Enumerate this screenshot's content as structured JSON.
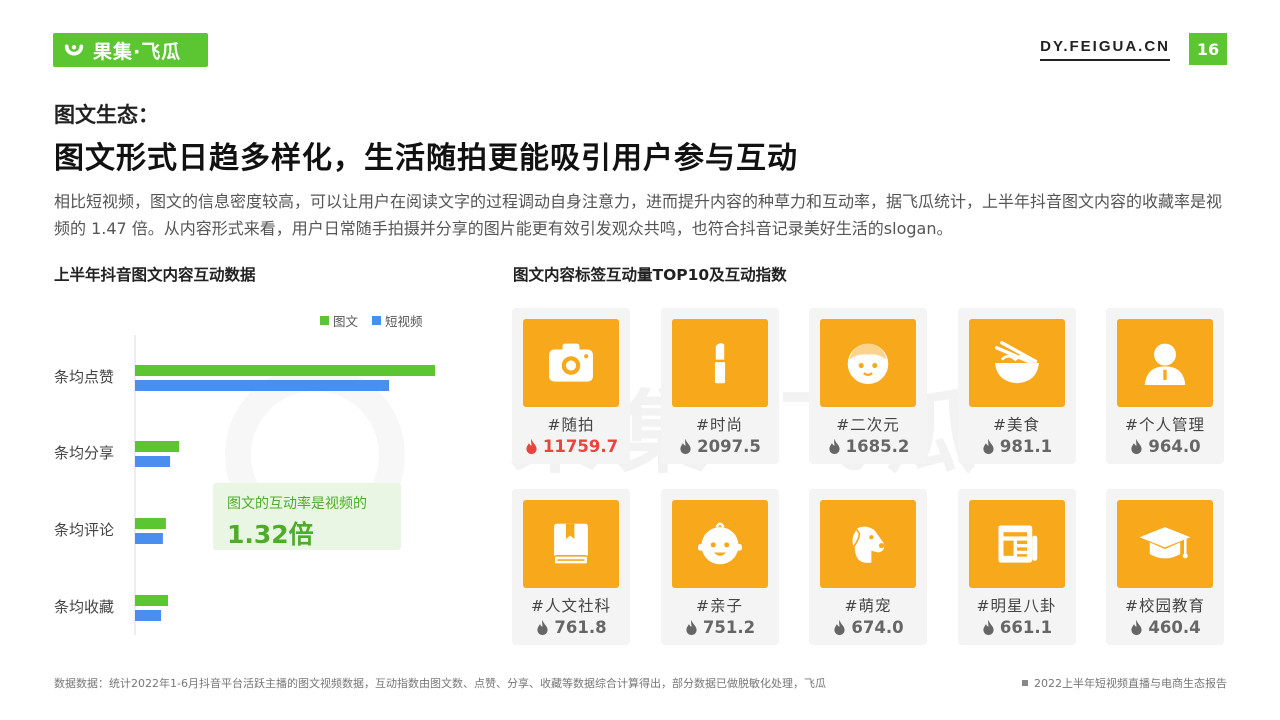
{
  "header": {
    "logo_text": "果集·飞瓜",
    "site": "DY.FEIGUA.CN",
    "page_number": "16"
  },
  "subtitle": "图文生态：",
  "title": "图文形式日趋多样化，生活随拍更能吸引用户参与互动",
  "description": "相比短视频，图文的信息密度较高，可以让用户在阅读文字的过程调动自身注意力，进而提升内容的种草力和互动率，据飞瓜统计，上半年抖音图文内容的收藏率是视频的 1.47 倍。从内容形式来看，用户日常随手拍摄并分享的图片能更有效引发观众共鸣，也符合抖音记录美好生活的slogan。",
  "left_section_title": "上半年抖音图文内容互动数据",
  "right_section_title": "图文内容标签互动量TOP10及互动指数",
  "callout": {
    "text": "图文的互动率是视频的",
    "value": "1.32倍"
  },
  "chart_data": {
    "type": "bar",
    "orientation": "horizontal",
    "categories": [
      "条均点赞",
      "条均分享",
      "条均评论",
      "条均收藏"
    ],
    "series": [
      {
        "name": "图文",
        "color": "#5cc532",
        "values": [
          100,
          14.7,
          10.3,
          11.0
        ]
      },
      {
        "name": "短视频",
        "color": "#4a8ef0",
        "values": [
          84.7,
          11.7,
          9.3,
          8.7
        ]
      }
    ],
    "xlim": [
      0,
      100
    ],
    "legend": "top-right",
    "grid": false
  },
  "tags": [
    {
      "name": "#随拍",
      "value": "11759.7",
      "icon": "camera-icon",
      "hot": true
    },
    {
      "name": "#时尚",
      "value": "2097.5",
      "icon": "lipstick-icon",
      "hot": false
    },
    {
      "name": "#二次元",
      "value": "1685.2",
      "icon": "anime-face-icon",
      "hot": false
    },
    {
      "name": "#美食",
      "value": "981.1",
      "icon": "noodle-bowl-icon",
      "hot": false
    },
    {
      "name": "#个人管理",
      "value": "964.0",
      "icon": "person-icon",
      "hot": false
    },
    {
      "name": "#人文社科",
      "value": "761.8",
      "icon": "book-icon",
      "hot": false
    },
    {
      "name": "#亲子",
      "value": "751.2",
      "icon": "baby-face-icon",
      "hot": false
    },
    {
      "name": "#萌宠",
      "value": "674.0",
      "icon": "dog-icon",
      "hot": false
    },
    {
      "name": "#明星八卦",
      "value": "661.1",
      "icon": "newspaper-icon",
      "hot": false
    },
    {
      "name": "#校园教育",
      "value": "460.4",
      "icon": "graduation-cap-icon",
      "hot": false
    }
  ],
  "colors": {
    "brand_green": "#5cc532",
    "video_blue": "#4a8ef0",
    "card_orange": "#f8a81b",
    "hot_red": "#e9443d"
  },
  "footer": {
    "source": "数据数据：统计2022年1-6月抖音平台活跃主播的图文视频数据，互动指数由图文数、点赞、分享、收藏等数据综合计算得出，部分数据已做脱敏化处理，飞瓜",
    "report": "2022上半年短视频直播与电商生态报告"
  }
}
